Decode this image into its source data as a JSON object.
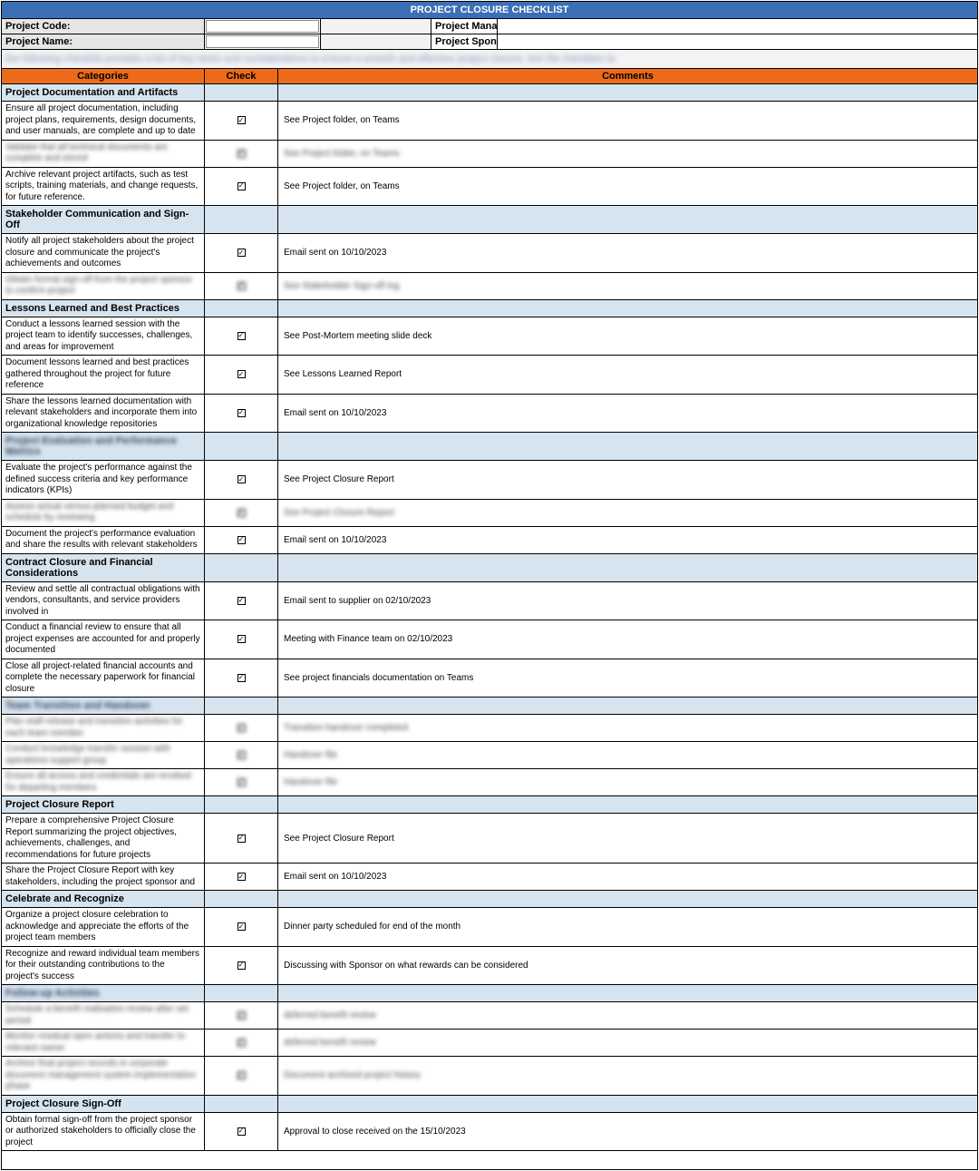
{
  "title": "PROJECT CLOSURE CHECKLIST",
  "header": {
    "projectCodeLabel": "Project Code:",
    "projectNameLabel": "Project Name:",
    "projectManagerLabel": "Project Manag",
    "projectSponsorLabel": "Project Sponso",
    "projectCodeValue": "",
    "projectNameValue": ""
  },
  "topBlur": "the following checklist provides a list of key tasks and considerations to ensure a smooth and effective project closure. tick the checkbox to",
  "columns": {
    "c1": "Categories",
    "c2": "Check",
    "c3": "Comments"
  },
  "sections": [
    {
      "title": "Project Documentation and Artifacts",
      "blur": false,
      "rows": [
        {
          "desc": "Ensure all project documentation, including project plans, requirements, design documents, and user manuals, are complete and up to date",
          "check": true,
          "comment": "See Project folder, on Teams",
          "blur": false
        },
        {
          "desc": "Validate that all technical documents are complete and stored",
          "check": true,
          "comment": "See Project folder, on Teams",
          "blur": true
        },
        {
          "desc": "Archive relevant project artifacts, such as test scripts, training materials, and change requests, for future reference.",
          "check": true,
          "comment": "See Project folder, on Teams",
          "blur": false
        }
      ]
    },
    {
      "title": "Stakeholder Communication and Sign-Off",
      "blur": false,
      "rows": [
        {
          "desc": "Notify all project stakeholders about the project closure and communicate the project's achievements and outcomes",
          "check": true,
          "comment": "Email sent on 10/10/2023",
          "blur": false
        },
        {
          "desc": "Obtain formal sign-off from the project sponsor to confirm project",
          "check": true,
          "comment": "See Stakeholder Sign-off log",
          "blur": true
        }
      ]
    },
    {
      "title": "Lessons Learned and Best Practices",
      "blur": false,
      "rows": [
        {
          "desc": "Conduct a lessons learned session with the project team to identify successes, challenges, and areas for improvement",
          "check": true,
          "comment": "See Post-Mortem meeting slide deck",
          "blur": false
        },
        {
          "desc": "Document lessons learned and best practices gathered throughout the project for future reference",
          "check": true,
          "comment": "See Lessons Learned Report",
          "blur": false
        },
        {
          "desc": "Share the lessons learned documentation with relevant stakeholders and incorporate them into organizational knowledge repositories",
          "check": true,
          "comment": "Email sent on 10/10/2023",
          "blur": false
        }
      ]
    },
    {
      "title": "Project Evaluation and Performance Metrics",
      "blur": true,
      "rows": [
        {
          "desc": "Evaluate the project's performance against the defined success criteria and key performance indicators (KPIs)",
          "check": true,
          "comment": "See Project Closure Report",
          "blur": false
        },
        {
          "desc": "Assess actual versus planned budget and schedule by reviewing",
          "check": true,
          "comment": "See Project Closure Report",
          "blur": true
        },
        {
          "desc": "Document the project's performance evaluation and share the results with relevant stakeholders",
          "check": true,
          "comment": "Email sent on 10/10/2023",
          "blur": false
        }
      ]
    },
    {
      "title": "Contract Closure and Financial Considerations",
      "blur": false,
      "rows": [
        {
          "desc": "Review and settle all contractual obligations with vendors, consultants, and service providers involved in",
          "check": true,
          "comment": "Email sent to supplier on 02/10/2023",
          "blur": false
        },
        {
          "desc": " Conduct a financial review to ensure that all project expenses are accounted for and properly documented",
          "check": true,
          "comment": "Meeting with Finance team on 02/10/2023",
          "blur": false
        },
        {
          "desc": "Close all project-related financial accounts and complete the necessary paperwork for financial closure",
          "check": true,
          "comment": "See project financials documentation on Teams",
          "blur": false
        }
      ]
    },
    {
      "title": "Team Transition and Handover",
      "blur": true,
      "rows": [
        {
          "desc": "Plan staff release and transition activities for each team member",
          "check": true,
          "comment": "Transition handover completed",
          "blur": true
        },
        {
          "desc": "Conduct knowledge transfer session with operations support group",
          "check": true,
          "comment": "Handover file",
          "blur": true
        },
        {
          "desc": "Ensure all access and credentials are revoked for departing members",
          "check": true,
          "comment": "Handover file",
          "blur": true
        }
      ]
    },
    {
      "title": "Project Closure Report",
      "blur": false,
      "rows": [
        {
          "desc": "Prepare a comprehensive Project Closure Report summarizing the project objectives, achievements, challenges, and recommendations for future projects",
          "check": true,
          "comment": "See Project Closure Report",
          "blur": false
        },
        {
          "desc": "Share the Project Closure Report with key stakeholders, including the project sponsor and",
          "check": true,
          "comment": "Email sent on 10/10/2023",
          "blur": false
        }
      ]
    },
    {
      "title": "Celebrate and Recognize",
      "blur": false,
      "rows": [
        {
          "desc": "Organize a project closure celebration to acknowledge and appreciate the efforts of the project team members",
          "check": true,
          "comment": "Dinner party scheduled for end of the month",
          "blur": false
        },
        {
          "desc": "Recognize and reward individual team members for their outstanding contributions to the project's success",
          "check": true,
          "comment": "Discussing with Sponsor on what rewards can be considered",
          "blur": false
        }
      ]
    },
    {
      "title": "Follow-up Activities",
      "blur": true,
      "rows": [
        {
          "desc": "Schedule a benefit realisation review after set period",
          "check": true,
          "comment": "deferred benefit review",
          "blur": true
        },
        {
          "desc": "Monitor residual open actions and transfer to relevant owner",
          "check": true,
          "comment": "deferred benefit review",
          "blur": true
        },
        {
          "desc": "Archive final project records in corporate document management system implementation phase",
          "check": true,
          "comment": "Document archived project history",
          "blur": true
        }
      ]
    },
    {
      "title": "Project Closure Sign-Off",
      "blur": false,
      "rows": [
        {
          "desc": "Obtain formal sign-off from the project sponsor or authorized stakeholders to officially close the project",
          "check": true,
          "comment": "Approval to close received on the 15/10/2023",
          "blur": false
        }
      ]
    }
  ]
}
